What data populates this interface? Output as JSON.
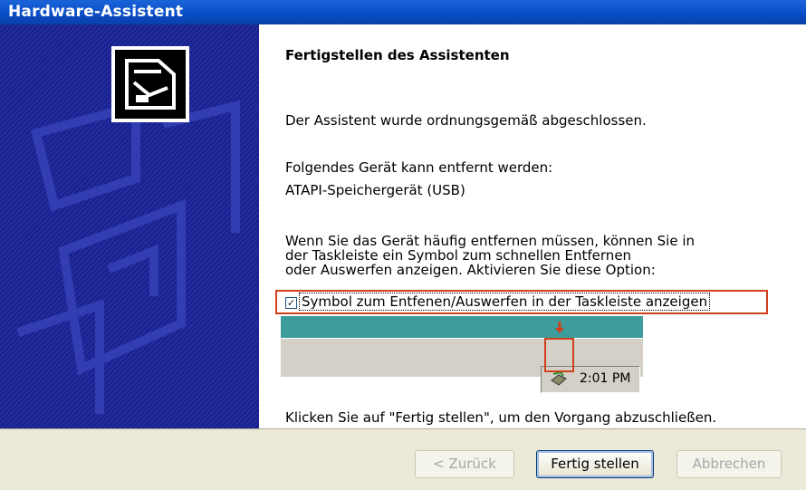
{
  "window": {
    "title": "Hardware-Assistent"
  },
  "content": {
    "heading": "Fertigstellen des Assistenten",
    "completed": "Der Assistent wurde ordnungsgemäß abgeschlossen.",
    "device_intro": "Folgendes Gerät kann entfernt werden:",
    "device_name": "ATAPI-Speichergerät (USB)",
    "hint_line1": "Wenn Sie das Gerät häufig entfernen müssen, können Sie in",
    "hint_line2": "der Taskleiste ein Symbol zum schnellen Entfernen",
    "hint_line3": "oder Auswerfen anzeigen. Aktivieren Sie diese Option:",
    "checkbox_label": "Symbol zum Entfenen/Auswerfen in der Taskleiste anzeigen",
    "checkbox_checked": true,
    "tray_clock": "2:01 PM",
    "finish_hint": "Klicken Sie auf \"Fertig stellen\", um den Vorgang abzuschließen."
  },
  "buttons": {
    "back": "< Zurück",
    "finish": "Fertig stellen",
    "cancel": "Abbrechen"
  },
  "colors": {
    "titlebar": "#0a4ec8",
    "sidebar": "#121a8c",
    "highlight": "#d0401a",
    "taskbar_top": "#3d9c9c"
  }
}
